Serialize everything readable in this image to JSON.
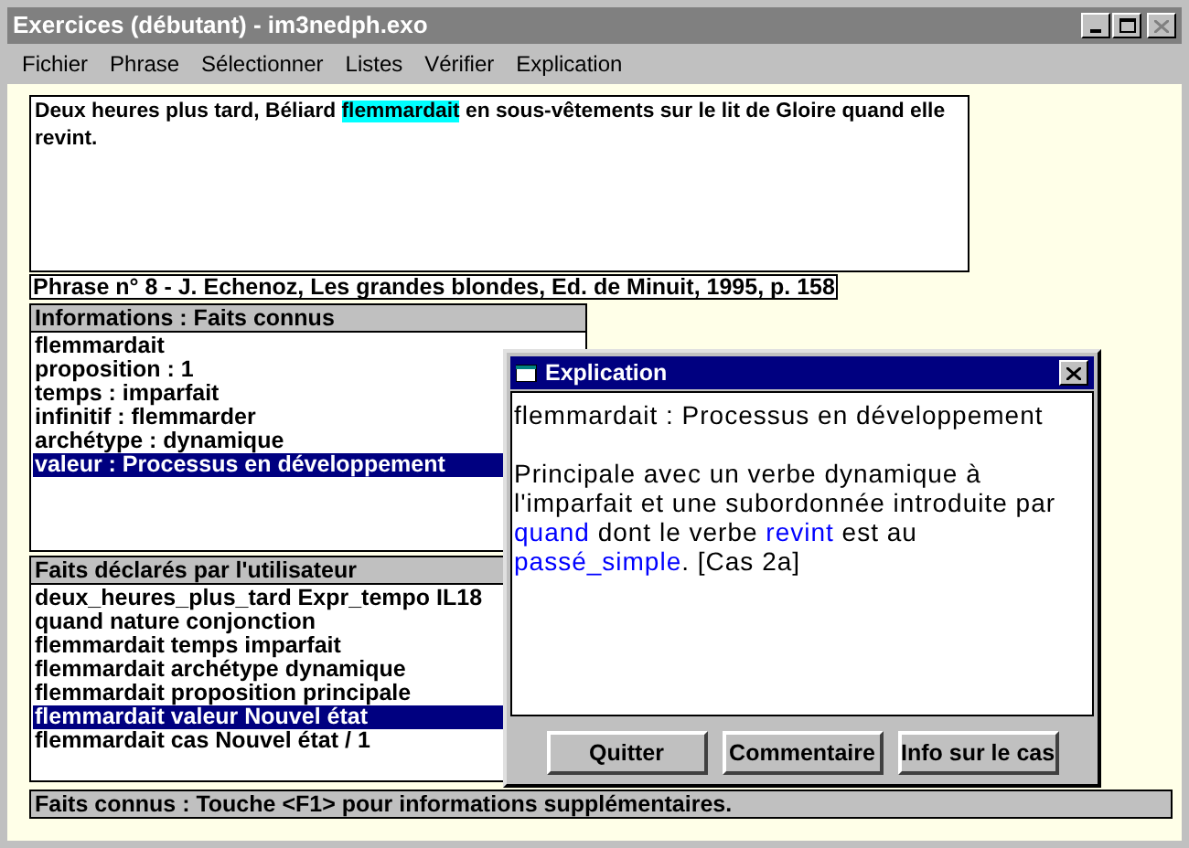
{
  "window": {
    "title": "Exercices (débutant) - im3nedph.exo"
  },
  "menu": [
    "Fichier",
    "Phrase",
    "Sélectionner",
    "Listes",
    "Vérifier",
    "Explication"
  ],
  "sentence": [
    {
      "text": "Deux heures plus tard, Béliard ",
      "highlighted": false
    },
    {
      "text": "flemmardait",
      "highlighted": true
    },
    {
      "text": " en sous-vêtements sur le lit de Gloire quand elle revint.",
      "highlighted": false
    }
  ],
  "citation": "Phrase n° 8 - J. Echenoz, Les grandes blondes, Ed. de Minuit, 1995, p. 158",
  "known_facts": {
    "header": "Informations : Faits connus",
    "items": [
      {
        "label": "flemmardait",
        "selected": false
      },
      {
        "label": "proposition : 1",
        "selected": false
      },
      {
        "label": "temps : imparfait",
        "selected": false
      },
      {
        "label": "infinitif : flemmarder",
        "selected": false
      },
      {
        "label": "archétype : dynamique",
        "selected": false
      },
      {
        "label": "valeur : Processus en développement",
        "selected": true
      }
    ]
  },
  "user_facts": {
    "header": "Faits déclarés par l'utilisateur",
    "items": [
      {
        "label": "deux_heures_plus_tard Expr_tempo IL18",
        "selected": false
      },
      {
        "label": "quand nature conjonction",
        "selected": false
      },
      {
        "label": "flemmardait temps imparfait",
        "selected": false
      },
      {
        "label": "flemmardait archétype dynamique",
        "selected": false
      },
      {
        "label": "flemmardait proposition principale",
        "selected": false
      },
      {
        "label": "flemmardait valeur Nouvel état",
        "selected": true
      },
      {
        "label": "flemmardait cas Nouvel état / 1",
        "selected": false
      }
    ]
  },
  "status_bar": "Faits connus : Touche <F1> pour informations supplémentaires.",
  "dialog": {
    "title": "Explication",
    "heading": "flemmardait : Processus en développement",
    "paragraph": [
      {
        "text": "Principale avec un verbe dynamique à l'imparfait et une subordonnée introduite par ",
        "link": false
      },
      {
        "text": "quand",
        "link": true
      },
      {
        "text": " dont le verbe ",
        "link": false
      },
      {
        "text": "revint",
        "link": true
      },
      {
        "text": " est au ",
        "link": false
      },
      {
        "text": "passé_simple",
        "link": true
      },
      {
        "text": ". [Cas 2a]",
        "link": false
      }
    ],
    "buttons": [
      "Quitter",
      "Commentaire",
      "Info sur le cas"
    ]
  }
}
